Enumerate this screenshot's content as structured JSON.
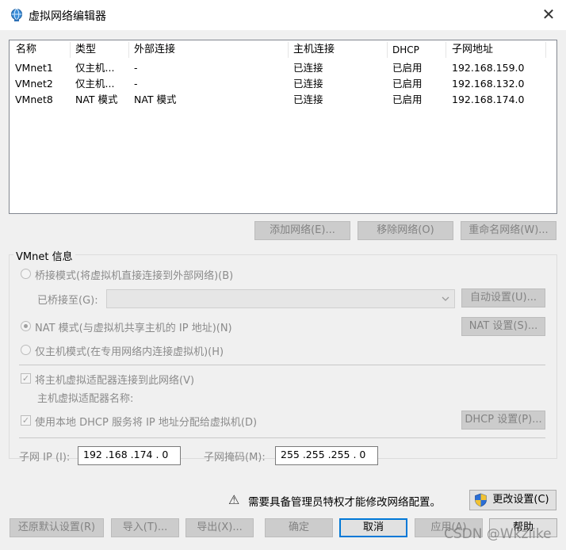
{
  "window": {
    "title": "虚拟网络编辑器",
    "close_glyph": "✕"
  },
  "list": {
    "columns": [
      "名称",
      "类型",
      "外部连接",
      "主机连接",
      "DHCP",
      "子网地址"
    ],
    "rows": [
      [
        "VMnet1",
        "仅主机...",
        "-",
        "已连接",
        "已启用",
        "192.168.159.0"
      ],
      [
        "VMnet2",
        "仅主机...",
        "-",
        "已连接",
        "已启用",
        "192.168.132.0"
      ],
      [
        "VMnet8",
        "NAT 模式",
        "NAT 模式",
        "已连接",
        "已启用",
        "192.168.174.0"
      ]
    ]
  },
  "list_buttons": {
    "add": "添加网络(E)...",
    "remove": "移除网络(O)",
    "rename": "重命名网络(W)..."
  },
  "vmnet_info": {
    "label": "VMnet 信息",
    "bridged": "桥接模式(将虚拟机直接连接到外部网络)(B)",
    "bridged_to": "已桥接至(G):",
    "auto_settings": "自动设置(U)...",
    "nat": "NAT 模式(与虚拟机共享主机的 IP 地址)(N)",
    "nat_settings": "NAT 设置(S)...",
    "host_only": "仅主机模式(在专用网络内连接虚拟机)(H)",
    "connect_adapter": "将主机虚拟适配器连接到此网络(V)",
    "adapter_name": "主机虚拟适配器名称:",
    "use_dhcp": "使用本地 DHCP 服务将 IP 地址分配给虚拟机(D)",
    "dhcp_settings": "DHCP 设置(P)...",
    "subnet_ip_label": "子网 IP (I):",
    "subnet_ip": "192 .168 .174 .  0",
    "subnet_mask_label": "子网掩码(M):",
    "subnet_mask": "255 .255 .255 .  0",
    "check_glyph": "✓"
  },
  "admin": {
    "message": "需要具备管理员特权才能修改网络配置。",
    "change_settings": "更改设置(C)",
    "warn_glyph": "⚠"
  },
  "footer": {
    "restore": "还原默认设置(R)",
    "import": "导入(T)...",
    "export": "导出(X)...",
    "ok": "确定",
    "cancel": "取消",
    "apply": "应用(A)",
    "help": "帮助"
  },
  "watermark": "CSDN @Wkzlike"
}
